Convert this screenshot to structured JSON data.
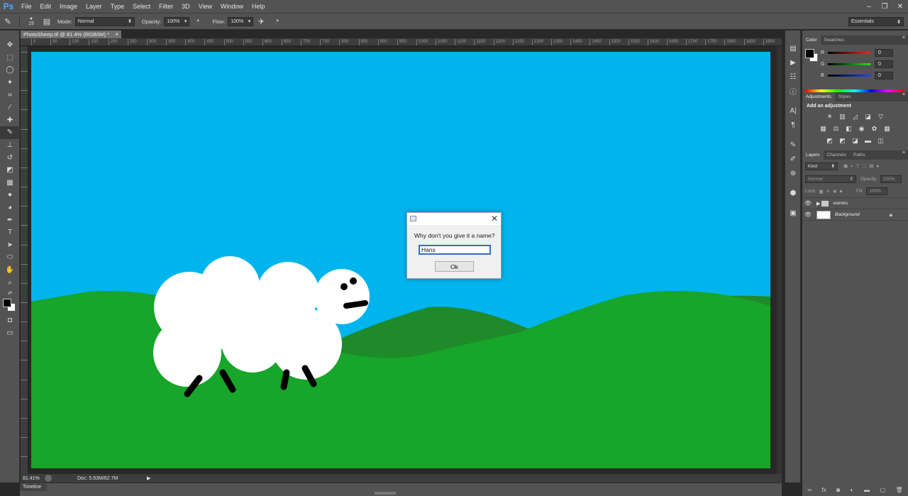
{
  "app": {
    "logo": "Ps"
  },
  "menu": [
    "File",
    "Edit",
    "Image",
    "Layer",
    "Type",
    "Select",
    "Filter",
    "3D",
    "View",
    "Window",
    "Help"
  ],
  "window_controls": [
    "–",
    "❐",
    "✕"
  ],
  "options_bar": {
    "brush_size": "19",
    "mode_label": "Mode:",
    "mode_value": "Normal",
    "opacity_label": "Opacity:",
    "opacity_value": "100%",
    "flow_label": "Flow:",
    "flow_value": "100%",
    "workspace": "Essentials"
  },
  "document": {
    "tab_title": "PhotoSheep.tif @ 81.4% (RGB/8#) *",
    "tab_close": "×",
    "ruler_h_ticks": [
      "0",
      "50",
      "100",
      "150",
      "200",
      "250",
      "300",
      "350",
      "400",
      "450",
      "500",
      "550",
      "600",
      "650",
      "700",
      "750",
      "800",
      "850",
      "900",
      "950",
      "1000",
      "1050",
      "1100",
      "1150",
      "1200",
      "1250",
      "1300",
      "1350",
      "1400",
      "1450",
      "1500",
      "1550",
      "1600",
      "1650",
      "1700",
      "1750",
      "1800",
      "1850",
      "1900"
    ],
    "colors": {
      "sky": "#00b4ee",
      "hill_dark": "#1f8a2a",
      "grass": "#17a52a",
      "sheep": "#ffffff",
      "sheep_features": "#000000"
    }
  },
  "status": {
    "zoom": "81.41%",
    "doc_size": "Doc: 5.93M/62.7M",
    "arrow": "▶"
  },
  "timeline": {
    "label": "Timeline"
  },
  "dialog": {
    "close": "✕",
    "prompt": "Why don't you give it a name?",
    "input_value": "Hans",
    "ok_label": "Ok"
  },
  "panels": {
    "color": {
      "tabs": [
        "Color",
        "Swatches"
      ],
      "sliders": [
        {
          "letter": "R",
          "value": "0",
          "color": "#e02020"
        },
        {
          "letter": "G",
          "value": "0",
          "color": "#20c020"
        },
        {
          "letter": "B",
          "value": "0",
          "color": "#2030e0"
        }
      ]
    },
    "adjustments": {
      "tabs": [
        "Adjustments",
        "Styles"
      ],
      "title": "Add an adjustment"
    },
    "layers": {
      "tabs": [
        "Layers",
        "Channels",
        "Paths"
      ],
      "kind": "Kind",
      "blend": "Normal",
      "opacity_label": "Opacity:",
      "opacity_value": "100%",
      "lock_label": "Lock:",
      "fill_label": "Fill:",
      "fill_value": "100%",
      "items": [
        {
          "name": "scenes",
          "type": "group"
        },
        {
          "name": "Background",
          "type": "layer"
        }
      ]
    }
  }
}
